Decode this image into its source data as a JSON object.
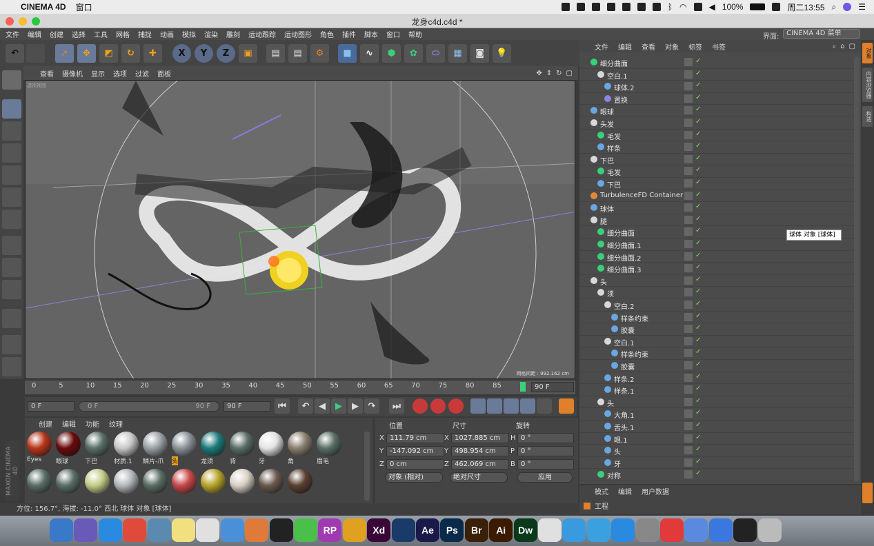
{
  "menubar": {
    "app": "CINEMA 4D",
    "menu": "窗口",
    "battery": "100%",
    "clock": "周二13:55"
  },
  "window": {
    "title": "龙身c4d.c4d *"
  },
  "main_menu": [
    "文件",
    "编辑",
    "创建",
    "选择",
    "工具",
    "网格",
    "捕捉",
    "动画",
    "模拟",
    "渲染",
    "雕刻",
    "运动跟踪",
    "运动图形",
    "角色",
    "插件",
    "脚本",
    "窗口",
    "帮助"
  ],
  "layout": {
    "label": "界面:",
    "value": "CINEMA 4D 菜单"
  },
  "toolbar": {
    "x": "X",
    "y": "Y",
    "z": "Z"
  },
  "viewport": {
    "menu": [
      "查看",
      "摄像机",
      "显示",
      "选项",
      "过滤",
      "面板"
    ],
    "label": "透视视图",
    "grid_info": "网格间距 : 992.162 cm"
  },
  "timeline": {
    "ticks": [
      "0",
      "5",
      "10",
      "15",
      "20",
      "25",
      "30",
      "35",
      "40",
      "45",
      "50",
      "55",
      "60",
      "65",
      "70",
      "75",
      "80",
      "85"
    ],
    "end": "90 F"
  },
  "anim": {
    "current": "0 F",
    "min": "0 F",
    "max": "90 F",
    "end": "90 F"
  },
  "materials": {
    "menu": [
      "创建",
      "编辑",
      "功能",
      "纹理"
    ],
    "items": [
      {
        "label": "Eyes",
        "color": "#b8351a"
      },
      {
        "label": "眼球",
        "color": "#6a0a0a"
      },
      {
        "label": "下巴",
        "color": "#5a6e66"
      },
      {
        "label": "材质.1",
        "color": "#c8c8c8"
      },
      {
        "label": "鳞片-爪",
        "color": "#9aa0a6"
      },
      {
        "label": "头",
        "color": "#8a9298"
      },
      {
        "label": "龙须",
        "color": "#1e7a7a"
      },
      {
        "label": "背",
        "color": "#5a6e66"
      },
      {
        "label": "牙",
        "color": "#e4e4e4"
      },
      {
        "label": "角",
        "color": "#8a7e70"
      },
      {
        "label": "眉毛",
        "color": "#5a6e66"
      },
      {
        "label": "",
        "color": "#5a6e66"
      },
      {
        "label": "",
        "color": "#5a6e66"
      },
      {
        "label": "",
        "color": "#c4cc88"
      },
      {
        "label": "",
        "color": "#b4b8bc"
      },
      {
        "label": "",
        "color": "#5a6e66"
      },
      {
        "label": "",
        "color": "#c8484a"
      },
      {
        "label": "",
        "color": "#b8a42a"
      },
      {
        "label": "",
        "color": "#d8d0c4"
      },
      {
        "label": "",
        "color": "#6a5a50"
      },
      {
        "label": "",
        "color": "#5a4032"
      }
    ]
  },
  "coords": {
    "headers": [
      "位置",
      "尺寸",
      "旋转"
    ],
    "pos": {
      "x": "111.79 cm",
      "y": "-147.092 cm",
      "z": "0 cm"
    },
    "size": {
      "x": "1027.885 cm",
      "y": "498.954 cm",
      "z": "462.069 cm"
    },
    "rot": {
      "h": "0 °",
      "p": "0 °",
      "b": "0 °"
    },
    "mode1": "对象 (相对)",
    "mode2": "绝对尺寸",
    "apply": "应用",
    "axis_labels": {
      "x": "X",
      "y": "Y",
      "z": "Z",
      "h": "H",
      "p": "P",
      "b": "B"
    }
  },
  "status": {
    "text": "方位: 156.7°, 海拔: -11.0° 西北    球体 对象 [球体]"
  },
  "object_manager": {
    "menu": [
      "文件",
      "编辑",
      "查看",
      "对象",
      "标签",
      "书签"
    ],
    "rows": [
      {
        "name": "细分曲面",
        "indent": 0,
        "icon": "#3ad07a"
      },
      {
        "name": "空白.1",
        "indent": 1,
        "icon": "#d8d8d8"
      },
      {
        "name": "球体.2",
        "indent": 2,
        "icon": "#6aa6e0"
      },
      {
        "name": "置换",
        "indent": 2,
        "icon": "#8a86e0"
      },
      {
        "name": "眼球",
        "indent": 0,
        "icon": "#6aa6e0"
      },
      {
        "name": "头发",
        "indent": 0,
        "icon": "#d8d8d8"
      },
      {
        "name": "毛发",
        "indent": 1,
        "icon": "#3ad07a"
      },
      {
        "name": "样条",
        "indent": 1,
        "icon": "#6aa6e0"
      },
      {
        "name": "下巴",
        "indent": 0,
        "icon": "#d8d8d8"
      },
      {
        "name": "毛发",
        "indent": 1,
        "icon": "#3ad07a"
      },
      {
        "name": "下巴",
        "indent": 1,
        "icon": "#6aa6e0"
      },
      {
        "name": "TurbulenceFD Container",
        "indent": 0,
        "icon": "#e08a3a"
      },
      {
        "name": "球体",
        "indent": 0,
        "icon": "#6aa6e0"
      },
      {
        "name": "腿",
        "indent": 0,
        "icon": "#d8d8d8"
      },
      {
        "name": "细分曲面",
        "indent": 1,
        "icon": "#3ad07a"
      },
      {
        "name": "细分曲面.1",
        "indent": 1,
        "icon": "#3ad07a"
      },
      {
        "name": "细分曲面.2",
        "indent": 1,
        "icon": "#3ad07a"
      },
      {
        "name": "细分曲面.3",
        "indent": 1,
        "icon": "#3ad07a"
      },
      {
        "name": "头",
        "indent": 0,
        "icon": "#d8d8d8"
      },
      {
        "name": "须",
        "indent": 1,
        "icon": "#d8d8d8"
      },
      {
        "name": "空白.2",
        "indent": 2,
        "icon": "#d8d8d8"
      },
      {
        "name": "样条约束",
        "indent": 3,
        "icon": "#6aa6e0"
      },
      {
        "name": "胶囊",
        "indent": 3,
        "icon": "#6aa6e0"
      },
      {
        "name": "空白.1",
        "indent": 2,
        "icon": "#d8d8d8"
      },
      {
        "name": "样条约束",
        "indent": 3,
        "icon": "#6aa6e0"
      },
      {
        "name": "胶囊",
        "indent": 3,
        "icon": "#6aa6e0"
      },
      {
        "name": "样条.2",
        "indent": 2,
        "icon": "#6aa6e0"
      },
      {
        "name": "样条.1",
        "indent": 2,
        "icon": "#6aa6e0"
      },
      {
        "name": "头",
        "indent": 1,
        "icon": "#d8d8d8"
      },
      {
        "name": "大角.1",
        "indent": 2,
        "icon": "#6aa6e0"
      },
      {
        "name": "舌头.1",
        "indent": 2,
        "icon": "#6aa6e0"
      },
      {
        "name": "眼.1",
        "indent": 2,
        "icon": "#6aa6e0"
      },
      {
        "name": "头",
        "indent": 2,
        "icon": "#6aa6e0"
      },
      {
        "name": "牙",
        "indent": 2,
        "icon": "#6aa6e0"
      },
      {
        "name": "对称",
        "indent": 1,
        "icon": "#3ad07a"
      }
    ]
  },
  "tooltip": "球体 对象 [球体]",
  "attributes": {
    "menu": [
      "模式",
      "编辑",
      "用户数据"
    ],
    "item": "工程"
  },
  "right_tabs": [
    "对象",
    "内容浏览器",
    "构造"
  ],
  "dock": [
    {
      "label": "",
      "color": "#3a78c8"
    },
    {
      "label": "",
      "color": "#6a5ab8"
    },
    {
      "label": "",
      "color": "#2a8ae0"
    },
    {
      "label": "",
      "color": "#e04a3a"
    },
    {
      "label": "",
      "color": "#5a8ab0"
    },
    {
      "label": "",
      "color": "#f0e080"
    },
    {
      "label": "",
      "color": "#e0e0e0"
    },
    {
      "label": "",
      "color": "#4a90d8"
    },
    {
      "label": "",
      "color": "#e07a3a"
    },
    {
      "label": "",
      "color": "#222222"
    },
    {
      "label": "",
      "color": "#4ac04a"
    },
    {
      "label": "RP",
      "color": "#a03ab0"
    },
    {
      "label": "",
      "color": "#e0a020"
    },
    {
      "label": "Xd",
      "color": "#3a0838"
    },
    {
      "label": "",
      "color": "#1a3a6a"
    },
    {
      "label": "Ae",
      "color": "#1a1a4a"
    },
    {
      "label": "Ps",
      "color": "#0a2a4a"
    },
    {
      "label": "Br",
      "color": "#3a2008"
    },
    {
      "label": "Ai",
      "color": "#3a1a00"
    },
    {
      "label": "Dw",
      "color": "#0a3a1a"
    },
    {
      "label": "",
      "color": "#e0e0e0"
    },
    {
      "label": "",
      "color": "#3a9ae0"
    },
    {
      "label": "",
      "color": "#3aa0e0"
    },
    {
      "label": "",
      "color": "#2a8ae0"
    },
    {
      "label": "",
      "color": "#888888"
    },
    {
      "label": "",
      "color": "#e03a3a"
    },
    {
      "label": "",
      "color": "#5a8ae0"
    },
    {
      "label": "",
      "color": "#3a78e0"
    },
    {
      "label": "",
      "color": "#222222"
    },
    {
      "label": "",
      "color": "#bbbbbb"
    }
  ]
}
